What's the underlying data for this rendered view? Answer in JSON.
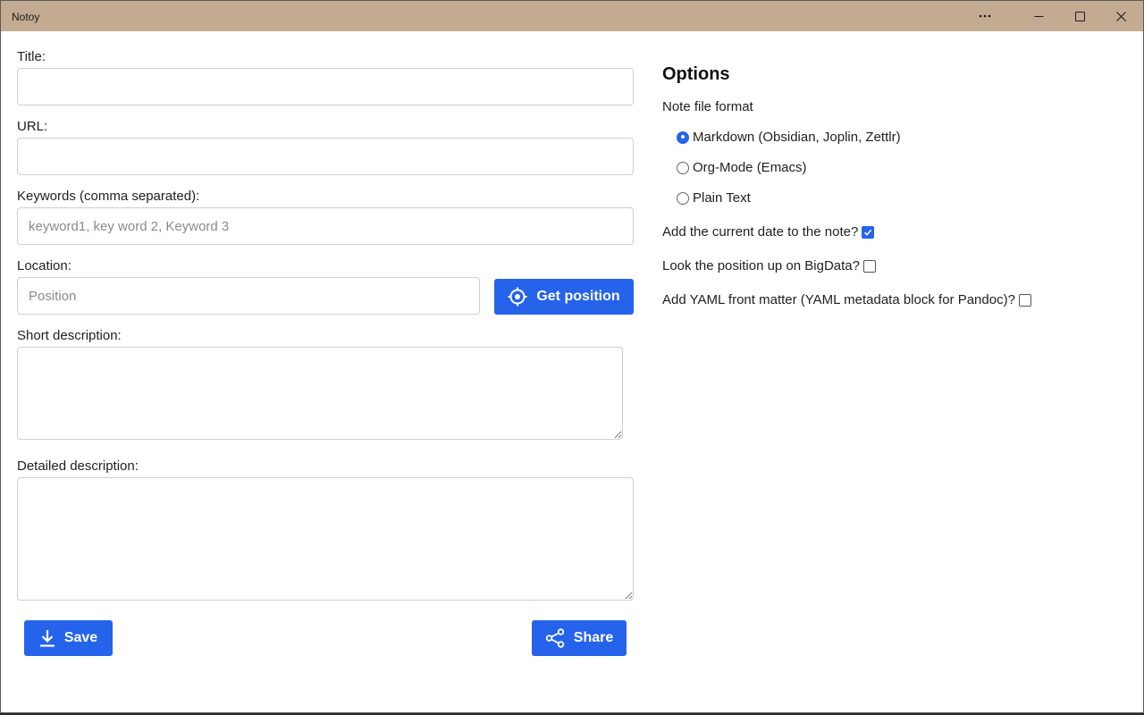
{
  "window": {
    "title": "Notoy",
    "controls": {
      "more": "more-icon",
      "minimize": "minimize-icon",
      "maximize": "maximize-icon",
      "close": "close-icon"
    }
  },
  "form": {
    "title_label": "Title:",
    "title_value": "",
    "url_label": "URL:",
    "url_value": "",
    "keywords_label": "Keywords (comma separated):",
    "keywords_placeholder": "keyword1, key word 2, Keyword 3",
    "location_label": "Location:",
    "location_placeholder": "Position",
    "get_position_label": "Get position",
    "short_desc_label": "Short description:",
    "detailed_desc_label": "Detailed description:",
    "save_label": "Save",
    "share_label": "Share"
  },
  "options": {
    "heading": "Options",
    "format_label": "Note file format",
    "formats": [
      {
        "label": "Markdown (Obsidian, Joplin, Zettlr)",
        "selected": true
      },
      {
        "label": "Org-Mode (Emacs)",
        "selected": false
      },
      {
        "label": "Plain Text",
        "selected": false
      }
    ],
    "add_date_label": "Add the current date to the note?",
    "add_date_checked": true,
    "lookup_label": "Look the position up on BigData?",
    "lookup_checked": false,
    "yaml_label": "Add YAML front matter (YAML metadata block for Pandoc)?",
    "yaml_checked": false
  },
  "colors": {
    "titlebar": "#c3ab91",
    "accent": "#2563eb"
  }
}
